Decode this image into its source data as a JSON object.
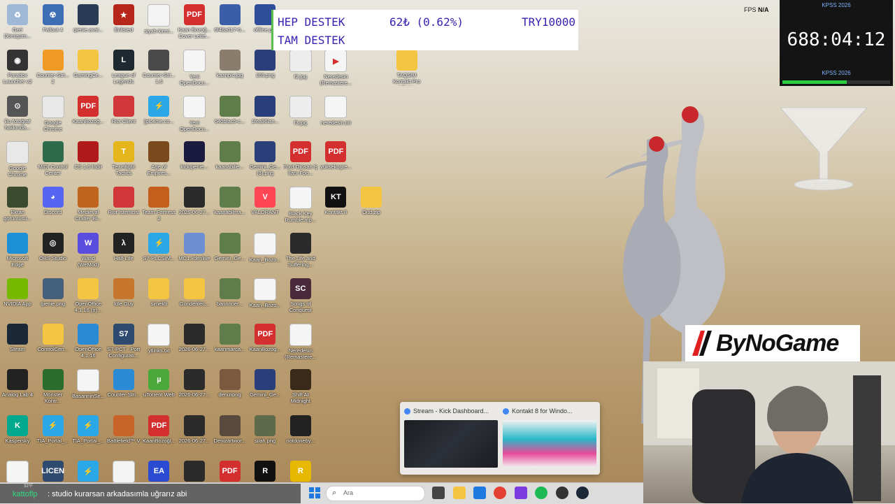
{
  "desktop_icons": [
    {
      "label": "Geri Dönüşüm...",
      "color": "#9fb8d6",
      "glyph": "♻",
      "col": 0,
      "row": 0
    },
    {
      "label": "Fallout 4",
      "color": "#3d6db5",
      "glyph": "☢",
      "col": 1,
      "row": 0
    },
    {
      "label": "qienie.avat...",
      "color": "#2a3c55",
      "glyph": "",
      "col": 2,
      "row": 0
    },
    {
      "label": "Enlisted",
      "color": "#b7261b",
      "glyph": "★",
      "col": 3,
      "row": 0
    },
    {
      "label": "siyah-kirmi...",
      "color": "#f3f3f3",
      "glyph": "",
      "col": 4,
      "row": 0
    },
    {
      "label": "Kaan Bozoğ... Cover Lette...",
      "color": "#d32f2f",
      "glyph": "PDF",
      "col": 5,
      "row": 0
    },
    {
      "label": "6f48a017-6...",
      "color": "#3b5ea8",
      "glyph": "",
      "col": 6,
      "row": 0
    },
    {
      "label": "offline.p...",
      "color": "#2f4e9a",
      "glyph": "",
      "col": 7,
      "row": 0
    },
    {
      "label": "Paradox Launcher v2",
      "color": "#333",
      "glyph": "◉",
      "col": 0,
      "row": 1
    },
    {
      "label": "Counter-Stri... 2",
      "color": "#f09a24",
      "glyph": "",
      "col": 1,
      "row": 1
    },
    {
      "label": "GamingCe...",
      "color": "#f3c540",
      "glyph": "",
      "col": 2,
      "row": 1
    },
    {
      "label": "League of Legends",
      "color": "#1e2a2f",
      "glyph": "L",
      "col": 3,
      "row": 1
    },
    {
      "label": "Counter-Stri... 1.6",
      "color": "#4a4a4a",
      "glyph": "",
      "col": 4,
      "row": 1
    },
    {
      "label": "Yeni OpenDocu...",
      "color": "#f5f5f5",
      "glyph": "",
      "col": 5,
      "row": 1
    },
    {
      "label": "kaanpic.jpg",
      "color": "#8b7d6b",
      "glyph": "",
      "col": 6,
      "row": 1
    },
    {
      "label": "169.png",
      "color": "#2a3f7a",
      "glyph": "",
      "col": 7,
      "row": 1
    },
    {
      "label": "f2.jpg",
      "color": "#ededed",
      "glyph": "",
      "col": 8,
      "row": 1
    },
    {
      "label": "Neredesin (Remastere...",
      "color": "#f5f5f5",
      "glyph": "▶",
      "col": 9,
      "row": 1
    },
    {
      "label": "TAQSIM Kontakt Pro Library",
      "color": "#f3c540",
      "glyph": "",
      "col": 11,
      "row": 1
    },
    {
      "label": "Bu fotoğraf hakkında...",
      "color": "#555",
      "glyph": "⊙",
      "col": 0,
      "row": 2
    },
    {
      "label": "Google Chrome",
      "color": "#e8e8e8",
      "glyph": "",
      "col": 1,
      "row": 2
    },
    {
      "label": "KaanBozoğ...",
      "color": "#d32f2f",
      "glyph": "PDF",
      "col": 2,
      "row": 2
    },
    {
      "label": "Riot Client",
      "color": "#d13639",
      "glyph": "",
      "col": 3,
      "row": 2
    },
    {
      "label": "[plc4me.co...",
      "color": "#2aa7e6",
      "glyph": "⚡",
      "col": 4,
      "row": 2
    },
    {
      "label": "Yeni OpenDocu...",
      "color": "#f5f5f5",
      "glyph": "",
      "col": 5,
      "row": 2
    },
    {
      "label": "640bfac5-c...",
      "color": "#5f7d4a",
      "glyph": "",
      "col": 6,
      "row": 2
    },
    {
      "label": "1fea96lan...",
      "color": "#2a3f7a",
      "glyph": "",
      "col": 7,
      "row": 2
    },
    {
      "label": "f3.jpg",
      "color": "#ededed",
      "glyph": "",
      "col": 8,
      "row": 2
    },
    {
      "label": "neredesin.txt",
      "color": "#f5f5f5",
      "glyph": "",
      "col": 9,
      "row": 2
    },
    {
      "label": "Google Chrome",
      "color": "#e8e8e8",
      "glyph": "",
      "col": 0,
      "row": 3
    },
    {
      "label": "MIDI Control Center",
      "color": "#2d6b4a",
      "glyph": "",
      "col": 1,
      "row": 3
    },
    {
      "label": "CS 1.6 İndir",
      "color": "#b01a1a",
      "glyph": "",
      "col": 2,
      "row": 3
    },
    {
      "label": "Teamfight Tactics",
      "color": "#e5b51c",
      "glyph": "T",
      "col": 3,
      "row": 3
    },
    {
      "label": "Age of Empires...",
      "color": "#7a4a1e",
      "glyph": "",
      "col": 4,
      "row": 3
    },
    {
      "label": "kickqienie...",
      "color": "#1b1b40",
      "glyph": "",
      "col": 5,
      "row": 3
    },
    {
      "label": "kaanabilie...",
      "color": "#5f7d4a",
      "glyph": "",
      "col": 6,
      "row": 3
    },
    {
      "label": "Gemini_Ge... (3).png",
      "color": "#2a3f7a",
      "glyph": "",
      "col": 7,
      "row": 3
    },
    {
      "label": "Ford Otosan İş İlanı Fon...",
      "color": "#d32f2f",
      "glyph": "PDF",
      "col": 8,
      "row": 3
    },
    {
      "label": "yuksekogre...",
      "color": "#d32f2f",
      "glyph": "PDF",
      "col": 9,
      "row": 3
    },
    {
      "label": "Ekran görüntüsü...",
      "color": "#3a4a2e",
      "glyph": "",
      "col": 0,
      "row": 4
    },
    {
      "label": "Discord",
      "color": "#5865f2",
      "glyph": "◕",
      "col": 1,
      "row": 4
    },
    {
      "label": "Medieval Crafter Bl...",
      "color": "#c0651e",
      "glyph": "",
      "col": 2,
      "row": 4
    },
    {
      "label": "Riot İstemcisi",
      "color": "#d13639",
      "glyph": "",
      "col": 3,
      "row": 4
    },
    {
      "label": "Team Fortress 2",
      "color": "#c45e1d",
      "glyph": "",
      "col": 4,
      "row": 4
    },
    {
      "label": "2026-06-27...",
      "color": "#2b2b2b",
      "glyph": "",
      "col": 5,
      "row": 4
    },
    {
      "label": "kaanabilma...",
      "color": "#5f7d4a",
      "glyph": "",
      "col": 6,
      "row": 4
    },
    {
      "label": "VALORANT",
      "color": "#ff4655",
      "glyph": "V",
      "col": 7,
      "row": 4
    },
    {
      "label": "Black Key Rumble.mp...",
      "color": "#f5f5f5",
      "glyph": "",
      "col": 8,
      "row": 4
    },
    {
      "label": "Kontakt 8",
      "color": "#111",
      "glyph": "KT",
      "col": 9,
      "row": 4
    },
    {
      "label": "Oud.zip",
      "color": "#f3c540",
      "glyph": "",
      "col": 10,
      "row": 4
    },
    {
      "label": "Microsoft Edge",
      "color": "#1c8fd6",
      "glyph": "",
      "col": 0,
      "row": 5
    },
    {
      "label": "OBS Studio",
      "color": "#222",
      "glyph": "◎",
      "col": 1,
      "row": 5
    },
    {
      "label": "Wand (WeMod)",
      "color": "#5b4ce0",
      "glyph": "W",
      "col": 2,
      "row": 5
    },
    {
      "label": "Half-Life",
      "color": "#222",
      "glyph": "λ",
      "col": 3,
      "row": 5
    },
    {
      "label": "S7-PLCSIM...",
      "color": "#2aa7e6",
      "glyph": "⚡",
      "col": 4,
      "row": 5
    },
    {
      "label": "MC1.kdenlive",
      "color": "#6d8fd4",
      "glyph": "",
      "col": 5,
      "row": 5
    },
    {
      "label": "Gemini_Ge...",
      "color": "#5f7d4a",
      "glyph": "",
      "col": 6,
      "row": 5
    },
    {
      "label": "Kaan_Bozo...",
      "color": "#f5f5f5",
      "glyph": "",
      "col": 7,
      "row": 5
    },
    {
      "label": "The Life and Suffering...",
      "color": "#2b2b2b",
      "glyph": "",
      "col": 8,
      "row": 5
    },
    {
      "label": "NVIDIA App",
      "color": "#76b900",
      "glyph": "",
      "col": 0,
      "row": 6
    },
    {
      "label": "qienie.png",
      "color": "#44607a",
      "glyph": "",
      "col": 1,
      "row": 6
    },
    {
      "label": "OpenOffice 4.1.16 (tr)...",
      "color": "#f3c540",
      "glyph": "",
      "col": 2,
      "row": 6
    },
    {
      "label": "Idle Guy",
      "color": "#c7762d",
      "glyph": "",
      "col": 3,
      "row": 6
    },
    {
      "label": "simekb",
      "color": "#f3c540",
      "glyph": "",
      "col": 4,
      "row": 6
    },
    {
      "label": "Gonderilec...",
      "color": "#f3c540",
      "glyph": "",
      "col": 5,
      "row": 6
    },
    {
      "label": "bannnner...",
      "color": "#5f7d4a",
      "glyph": "",
      "col": 6,
      "row": 6
    },
    {
      "label": "Kaan_Bozo...",
      "color": "#f5f5f5",
      "glyph": "",
      "col": 7,
      "row": 6
    },
    {
      "label": "Songs of Conquest",
      "color": "#4a2a3a",
      "glyph": "SC",
      "col": 8,
      "row": 6
    },
    {
      "label": "Steam",
      "color": "#1b2838",
      "glyph": "",
      "col": 0,
      "row": 7
    },
    {
      "label": "ControlCen...",
      "color": "#f3c540",
      "glyph": "",
      "col": 1,
      "row": 7
    },
    {
      "label": "OpenOffice 4.1.16",
      "color": "#2a8ad4",
      "glyph": "",
      "col": 2,
      "row": 7
    },
    {
      "label": "S7-PCT - Port Configurati...",
      "color": "#2e4a6e",
      "glyph": "S7",
      "col": 3,
      "row": 7
    },
    {
      "label": "ytlinks.txt",
      "color": "#f5f5f5",
      "glyph": "",
      "col": 4,
      "row": 7
    },
    {
      "label": "2026-06-27...",
      "color": "#2b2b2b",
      "glyph": "",
      "col": 5,
      "row": 7
    },
    {
      "label": "kaanmarca...",
      "color": "#5f7d4a",
      "glyph": "",
      "col": 6,
      "row": 7
    },
    {
      "label": "KaanBozog...",
      "color": "#d32f2f",
      "glyph": "PDF",
      "col": 7,
      "row": 7
    },
    {
      "label": "Neredesin (Remastere...",
      "color": "#f5f5f5",
      "glyph": "",
      "col": 8,
      "row": 7
    },
    {
      "label": "Analog Lab 4",
      "color": "#222",
      "glyph": "",
      "col": 0,
      "row": 8
    },
    {
      "label": "Monster Kontr...",
      "color": "#2a6b2e",
      "glyph": "",
      "col": 1,
      "row": 8
    },
    {
      "label": "BasarininSir...",
      "color": "#f5f5f5",
      "glyph": "",
      "col": 2,
      "row": 8
    },
    {
      "label": "Counter-Stri...",
      "color": "#2a8ad4",
      "glyph": "",
      "col": 3,
      "row": 8
    },
    {
      "label": "uTorrent Web",
      "color": "#4ba83a",
      "glyph": "µ",
      "col": 4,
      "row": 8
    },
    {
      "label": "2026-06-27...",
      "color": "#2b2b2b",
      "glyph": "",
      "col": 5,
      "row": 8
    },
    {
      "label": "denizipng",
      "color": "#7a5a3e",
      "glyph": "",
      "col": 6,
      "row": 8
    },
    {
      "label": "Gemini_Ge...",
      "color": "#2a3f7a",
      "glyph": "",
      "col": 7,
      "row": 8
    },
    {
      "label": "Shift At Midnight",
      "color": "#3a2a1a",
      "glyph": "",
      "col": 8,
      "row": 8
    },
    {
      "label": "Kaspersky",
      "color": "#00a88e",
      "glyph": "K",
      "col": 0,
      "row": 9
    },
    {
      "label": "TIA_Portal_...",
      "color": "#2aa7e6",
      "glyph": "⚡",
      "col": 1,
      "row": 9
    },
    {
      "label": "TIA_Portal_...",
      "color": "#2aa7e6",
      "glyph": "⚡",
      "col": 2,
      "row": 9
    },
    {
      "label": "Battlefield™ V",
      "color": "#c8642a",
      "glyph": "",
      "col": 3,
      "row": 9
    },
    {
      "label": "KaanBozoğl...",
      "color": "#d32f2f",
      "glyph": "PDF",
      "col": 4,
      "row": 9
    },
    {
      "label": "2026-06-27...",
      "color": "#2b2b2b",
      "glyph": "",
      "col": 5,
      "row": 9
    },
    {
      "label": "Denizartwor...",
      "color": "#5a4a3e",
      "glyph": "",
      "col": 6,
      "row": 9
    },
    {
      "label": "silah.png",
      "color": "#5f6a4a",
      "glyph": "",
      "col": 7,
      "row": 9
    },
    {
      "label": "notdoneby...",
      "color": "#222",
      "glyph": "",
      "col": 8,
      "row": 9
    },
    {
      "label": "",
      "color": "#f5f5f5",
      "glyph": "",
      "col": 0,
      "row": 10
    },
    {
      "label": "",
      "color": "#2e4a6e",
      "glyph": "LICEN",
      "col": 1,
      "row": 10
    },
    {
      "label": "",
      "color": "#2aa7e6",
      "glyph": "⚡",
      "col": 2,
      "row": 10
    },
    {
      "label": "",
      "color": "#f3f3f3",
      "glyph": "",
      "col": 3,
      "row": 10
    },
    {
      "label": "",
      "color": "#2a4ad4",
      "glyph": "EA",
      "col": 4,
      "row": 10
    },
    {
      "label": "",
      "color": "#2b2b2b",
      "glyph": "",
      "col": 5,
      "row": 10
    },
    {
      "label": "",
      "color": "#d32f2f",
      "glyph": "PDF",
      "col": 6,
      "row": 10
    },
    {
      "label": "",
      "color": "#111",
      "glyph": "R",
      "col": 7,
      "row": 10
    },
    {
      "label": "",
      "color": "#e6b800",
      "glyph": "R",
      "col": 8,
      "row": 10
    }
  ],
  "donation": {
    "line1": "HEP DESTEK",
    "amount": "62₺ (0.62%)",
    "goal": "TRY10000",
    "line2": "TAM DESTEK"
  },
  "fps": {
    "label": "FPS",
    "value": "N/A"
  },
  "timer": {
    "top_label": "KPSS 2026",
    "value": "688:04:12",
    "bottom_label": "KPSS 2026",
    "progress": 0.6
  },
  "brand": {
    "name": "ByNoGame"
  },
  "preview": {
    "tabs": [
      {
        "title": "Stream - Kick Dashboard..."
      },
      {
        "title": "Kontakt 8 for Windo..."
      }
    ]
  },
  "chat": {
    "temp": "32°F",
    "user": "kattoflp",
    "message": ": studio kurarsan arkadasımla uğrarız abi"
  },
  "taskbar": {
    "search_placeholder": "Ara"
  },
  "colors": {
    "accent": "#59c04a",
    "donation_text": "#3a1fb0",
    "timer_bar": "#2ecc40"
  }
}
